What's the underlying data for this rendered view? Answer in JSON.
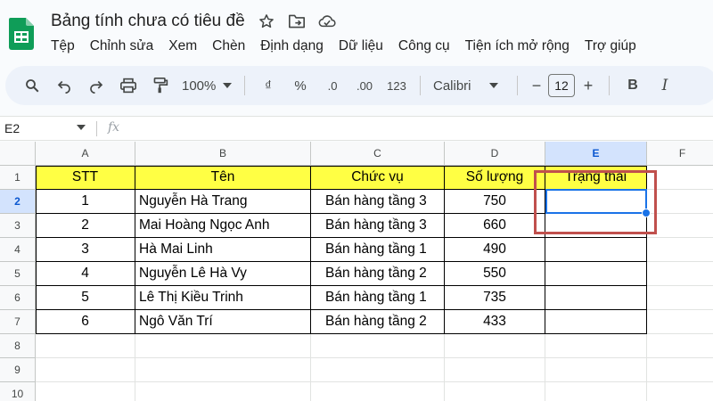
{
  "app": {
    "doc_title": "Bảng tính chưa có tiêu đề",
    "menu": [
      "Tệp",
      "Chỉnh sửa",
      "Xem",
      "Chèn",
      "Định dạng",
      "Dữ liệu",
      "Công cụ",
      "Tiện ích mở rộng",
      "Trợ giúp"
    ]
  },
  "toolbar": {
    "zoom": "100%",
    "currency": "₫",
    "percent": "%",
    "dec_decrease": ".0",
    "dec_increase": ".00",
    "number_format": "123",
    "font": "Calibri",
    "font_size": "12",
    "bold": "B",
    "italic": "I",
    "minus": "−",
    "plus": "+"
  },
  "formula_bar": {
    "cell_ref": "E2",
    "fx": "fx"
  },
  "grid": {
    "columns": [
      "A",
      "B",
      "C",
      "D",
      "E",
      "F"
    ],
    "rows": [
      "1",
      "2",
      "3",
      "4",
      "5",
      "6",
      "7",
      "8",
      "9",
      "10"
    ],
    "selected_column": "E",
    "selected_row": "2",
    "header": [
      "STT",
      "Tên",
      "Chức vụ",
      "Số lượng",
      "Trạng thái"
    ],
    "data": [
      [
        "1",
        "Nguyễn Hà Trang",
        "Bán hàng tầng 3",
        "750",
        ""
      ],
      [
        "2",
        "Mai Hoàng Ngọc Anh",
        "Bán hàng tầng 3",
        "660",
        ""
      ],
      [
        "3",
        "Hà Mai Linh",
        "Bán hàng tầng 1",
        "490",
        ""
      ],
      [
        "4",
        "Nguyễn Lê Hà Vy",
        "Bán hàng tầng 2",
        "550",
        ""
      ],
      [
        "5",
        "Lê Thị Kiều Trinh",
        "Bán hàng tầng 1",
        "735",
        ""
      ],
      [
        "6",
        "Ngô Văn Trí",
        "Bán hàng tầng 2",
        "433",
        ""
      ]
    ]
  },
  "colors": {
    "header_fill": "#ffff44",
    "selection": "#1a73e8",
    "highlight_box": "#c0504d",
    "logo": "#0f9d58"
  }
}
